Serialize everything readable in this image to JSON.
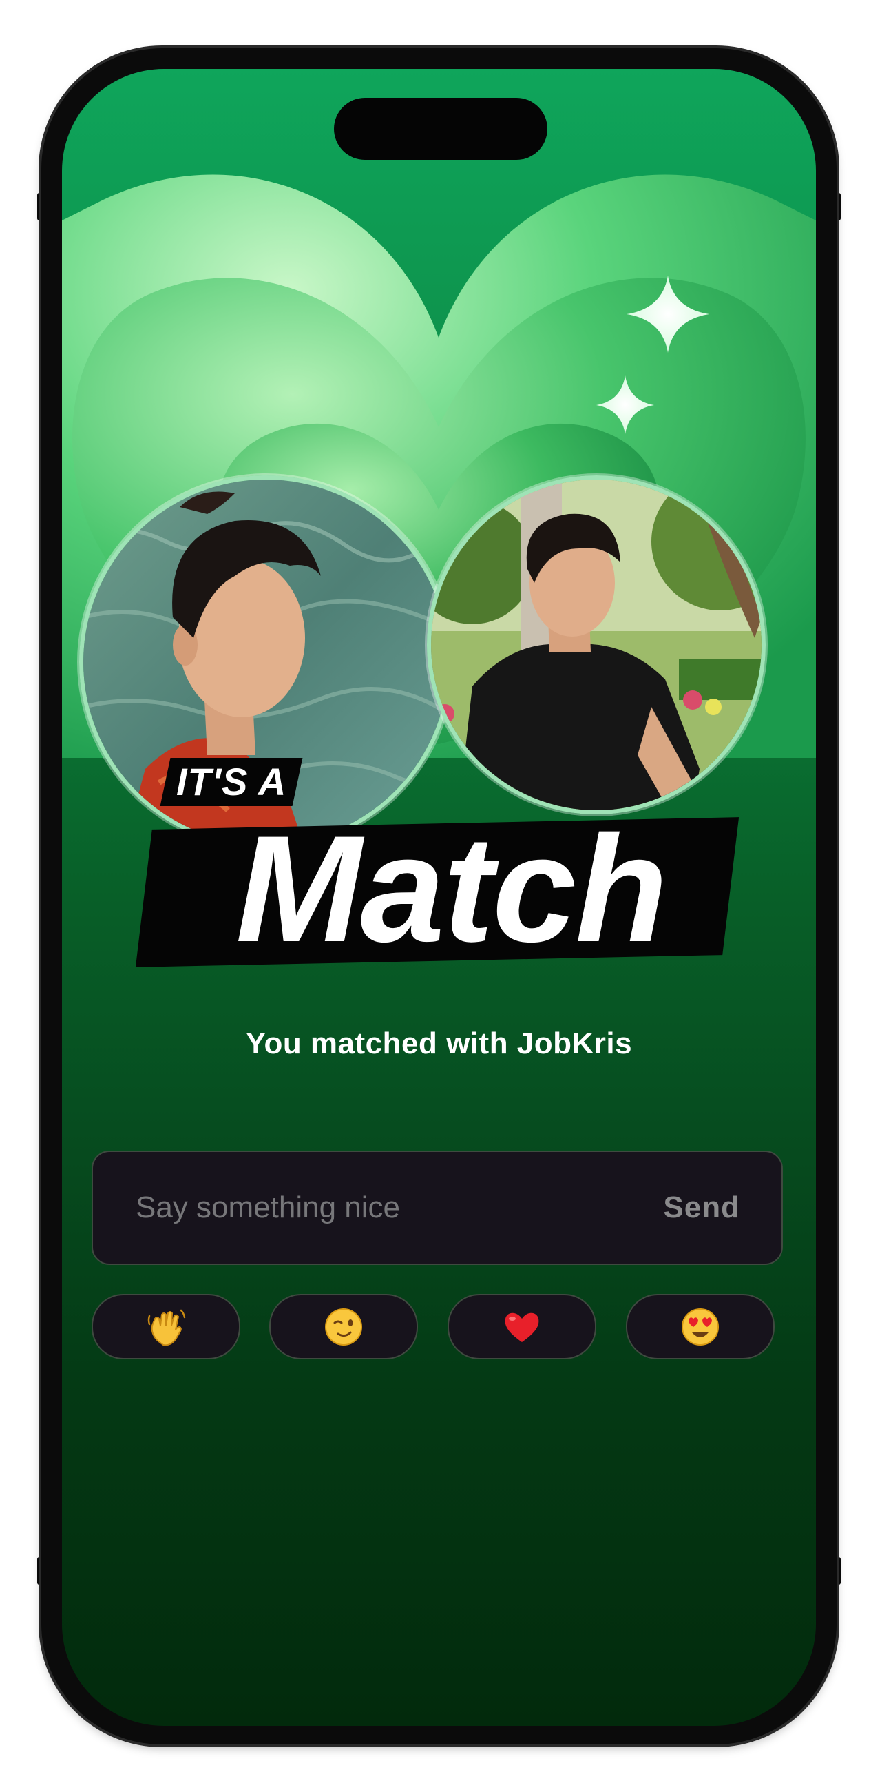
{
  "badge": {
    "prefix": "IT'S A",
    "title": "Match"
  },
  "subtitle": "You matched with JobKris",
  "message": {
    "placeholder": "Say something nice",
    "value": "",
    "send_label": "Send"
  },
  "quick_reactions": [
    {
      "icon": "waving-hand-icon"
    },
    {
      "icon": "winking-face-icon"
    },
    {
      "icon": "red-heart-icon"
    },
    {
      "icon": "heart-eyes-face-icon"
    }
  ],
  "profiles": [
    {
      "icon": "user-avatar"
    },
    {
      "icon": "match-avatar"
    }
  ],
  "colors": {
    "screen_top": "#0fa55b",
    "screen_bottom": "#022a0c",
    "heart_light": "#7fe89e",
    "input_bg": "#17131c",
    "text": "#ffffff",
    "placeholder": "#77777a"
  }
}
